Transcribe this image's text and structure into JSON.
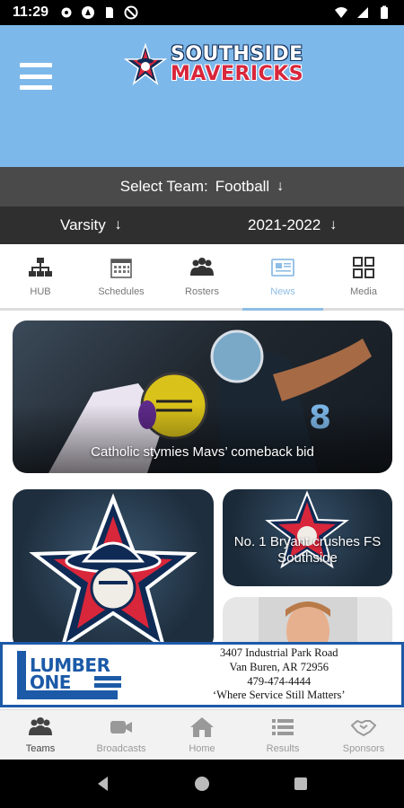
{
  "status_bar": {
    "time": "11:29",
    "left_icons": [
      "gear-icon",
      "vpn-icon",
      "sd-card-icon",
      "data-saver-icon"
    ],
    "right_icons": [
      "wifi-icon",
      "signal-icon",
      "battery-icon"
    ]
  },
  "header": {
    "logo_line1": "SOUTHSIDE",
    "logo_line2": "MAVERICKS",
    "bg_color": "#7db8ea"
  },
  "team_select": {
    "label": "Select Team:",
    "value": "Football"
  },
  "filters": {
    "level": "Varsity",
    "season": "2021-2022"
  },
  "tabs": [
    {
      "label": "HUB",
      "icon": "hierarchy-icon",
      "active": false
    },
    {
      "label": "Schedules",
      "icon": "calendar-icon",
      "active": false
    },
    {
      "label": "Rosters",
      "icon": "group-icon",
      "active": false
    },
    {
      "label": "News",
      "icon": "newspaper-icon",
      "active": true
    },
    {
      "label": "Media",
      "icon": "grid-icon",
      "active": false
    }
  ],
  "news": {
    "main_caption": "Catholic stymies Mavs’ comeback bid",
    "right_top_caption": "No. 1 Bryant crushes FS Southside"
  },
  "ad": {
    "brand_line1": "LUMBER",
    "brand_line2": "ONE",
    "address1": "3407 Industrial Park Road",
    "address2": "Van Buren, AR 72956",
    "phone": "479-474-4444",
    "slogan": "‘Where Service Still Matters’"
  },
  "bottom_nav": [
    {
      "label": "Teams",
      "icon": "group-icon",
      "active": true
    },
    {
      "label": "Broadcasts",
      "icon": "video-camera-icon",
      "active": false
    },
    {
      "label": "Home",
      "icon": "home-icon",
      "active": false
    },
    {
      "label": "Results",
      "icon": "list-icon",
      "active": false
    },
    {
      "label": "Sponsors",
      "icon": "handshake-icon",
      "active": false
    }
  ]
}
